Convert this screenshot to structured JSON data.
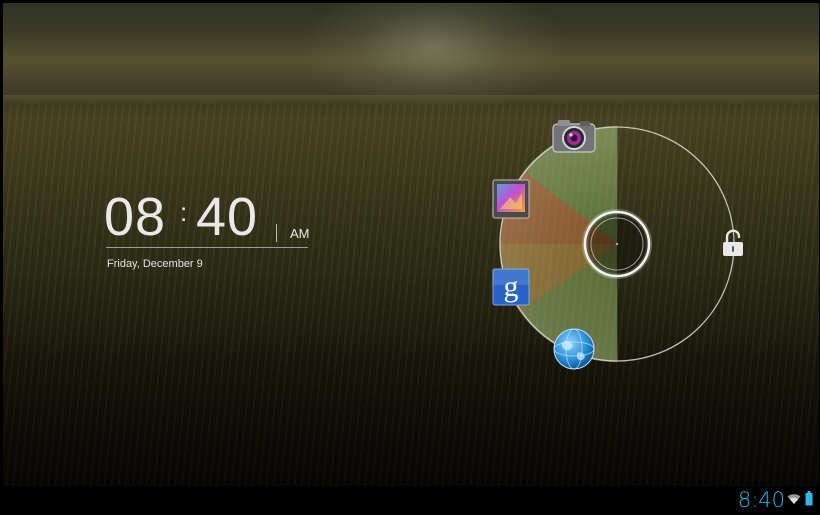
{
  "lockscreen": {
    "clock": {
      "hours": "08",
      "separator": ":",
      "minutes": "40",
      "ampm": "AM"
    },
    "date": "Friday, December 9",
    "targets": [
      {
        "name": "Camera",
        "icon": "camera-icon"
      },
      {
        "name": "Gallery",
        "icon": "gallery-icon"
      },
      {
        "name": "Google Search",
        "icon": "google-icon"
      },
      {
        "name": "Browser",
        "icon": "globe-icon"
      },
      {
        "name": "Unlock",
        "icon": "lock-open-icon"
      }
    ],
    "google_glyph": "g"
  },
  "statusbar": {
    "time": "8:40",
    "icons": [
      "wifi-icon",
      "battery-icon"
    ],
    "accent": "#33b5e5"
  }
}
